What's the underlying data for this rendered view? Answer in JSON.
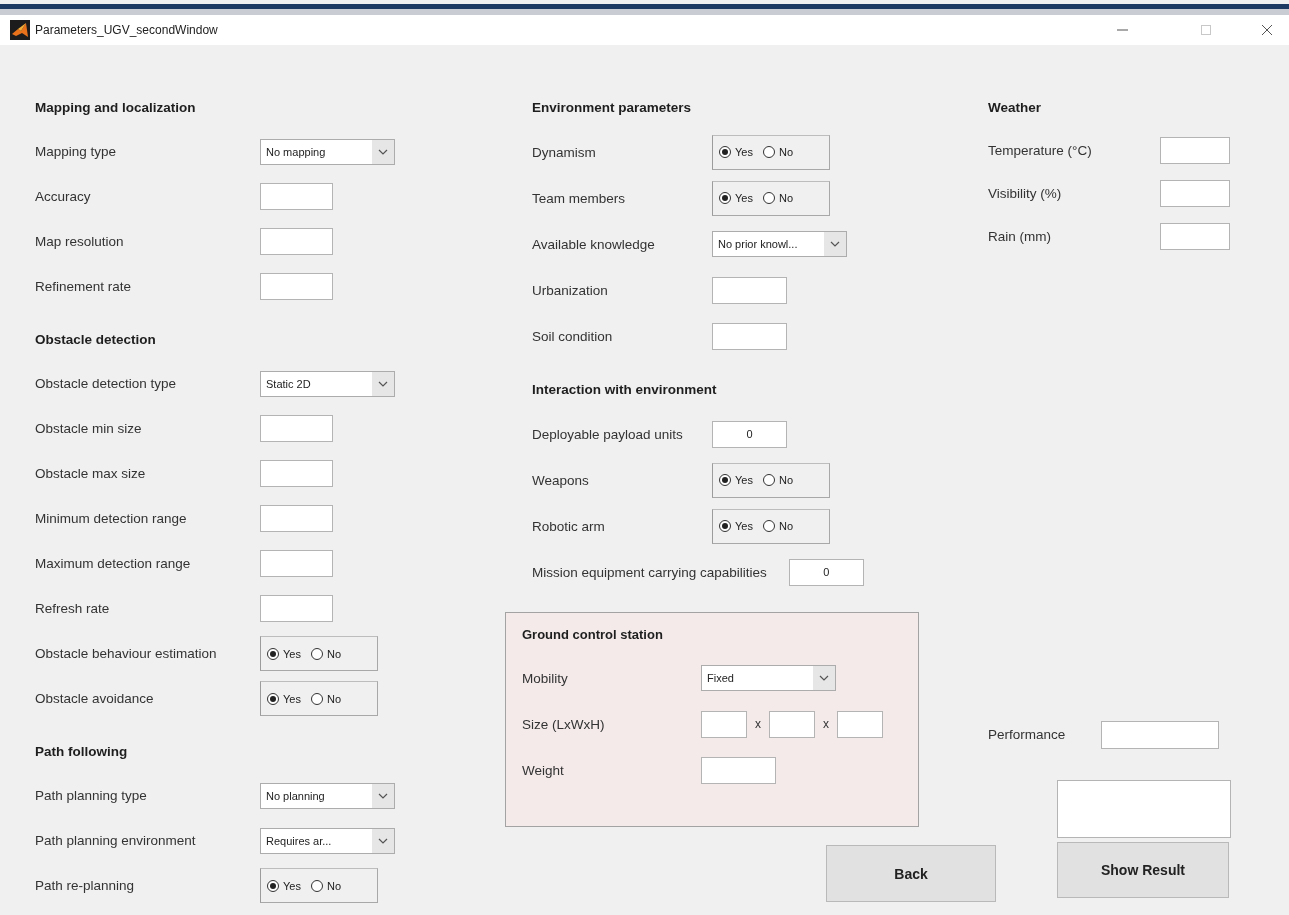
{
  "window": {
    "title": "Parameters_UGV_secondWindow"
  },
  "columns": [
    {
      "sections": [
        {
          "kind": "plain",
          "heading": "Mapping and localization",
          "rows": [
            {
              "label": "Mapping type",
              "kind": "dropdown",
              "value": "No mapping"
            },
            {
              "label": "Accuracy",
              "kind": "field"
            },
            {
              "label": "Map resolution",
              "kind": "field"
            },
            {
              "label": "Refinement rate",
              "kind": "field"
            }
          ]
        },
        {
          "kind": "plain",
          "heading": "Obstacle detection",
          "rows": [
            {
              "label": "Obstacle detection type",
              "kind": "dropdown",
              "value": "Static 2D"
            },
            {
              "label": "Obstacle min size",
              "kind": "field"
            },
            {
              "label": "Obstacle max size",
              "kind": "field"
            },
            {
              "label": "Minimum detection range",
              "kind": "field"
            },
            {
              "label": "Maximum detection range",
              "kind": "field"
            },
            {
              "label": "Refresh rate",
              "kind": "field"
            },
            {
              "label": "Obstacle behaviour estimation",
              "kind": "radio",
              "options": [
                {
                  "label": "Yes",
                  "selected": true
                },
                {
                  "label": "No",
                  "selected": false
                }
              ]
            },
            {
              "label": "Obstacle avoidance",
              "kind": "radio",
              "options": [
                {
                  "label": "Yes",
                  "selected": true
                },
                {
                  "label": "No",
                  "selected": false
                }
              ]
            }
          ]
        },
        {
          "kind": "plain",
          "heading": "Path following",
          "rows": [
            {
              "label": "Path planning type",
              "kind": "dropdown",
              "value": "No planning"
            },
            {
              "label": "Path planning environment",
              "kind": "dropdown",
              "value": "Requires ar..."
            },
            {
              "label": "Path re-planning",
              "kind": "radio",
              "options": [
                {
                  "label": "Yes",
                  "selected": true
                },
                {
                  "label": "No",
                  "selected": false
                }
              ]
            }
          ]
        }
      ]
    },
    {
      "sections": [
        {
          "kind": "plain",
          "heading": "Environment parameters",
          "rows": [
            {
              "label": "Dynamism",
              "kind": "radio",
              "options": [
                {
                  "label": "Yes",
                  "selected": true
                },
                {
                  "label": "No",
                  "selected": false
                }
              ]
            },
            {
              "label": "Team members",
              "kind": "radio",
              "options": [
                {
                  "label": "Yes",
                  "selected": true
                },
                {
                  "label": "No",
                  "selected": false
                }
              ]
            },
            {
              "label": "Available knowledge",
              "kind": "dropdown",
              "value": "No prior knowl..."
            },
            {
              "label": "Urbanization",
              "kind": "field"
            },
            {
              "label": "Soil condition",
              "kind": "field"
            }
          ]
        },
        {
          "kind": "plain",
          "heading": "Interaction with environment",
          "rows": [
            {
              "label": "Deployable payload units",
              "kind": "field",
              "value": "0"
            },
            {
              "label": "Weapons",
              "kind": "radio",
              "options": [
                {
                  "label": "Yes",
                  "selected": true
                },
                {
                  "label": "No",
                  "selected": false
                }
              ]
            },
            {
              "label": "Robotic arm",
              "kind": "radio",
              "options": [
                {
                  "label": "Yes",
                  "selected": true
                },
                {
                  "label": "No",
                  "selected": false
                }
              ]
            },
            {
              "label": "Mission equipment carrying capabilities",
              "kind": "field",
              "value": "0"
            }
          ]
        },
        {
          "kind": "panel",
          "heading": "Ground control station",
          "rows": [
            {
              "label": "Mobility",
              "kind": "dropdown",
              "value": "Fixed"
            },
            {
              "label": "Size (LxWxH)",
              "kind": "dimensions",
              "separators": [
                "x",
                "x"
              ]
            },
            {
              "label": "Weight",
              "kind": "field"
            }
          ]
        }
      ],
      "footer": [
        {
          "kind": "button",
          "label": "Back"
        }
      ]
    },
    {
      "sections": [
        {
          "kind": "plain",
          "heading": "Weather",
          "rows": [
            {
              "label": "Temperature (°C)",
              "kind": "field"
            },
            {
              "label": "Visibility (%)",
              "kind": "field"
            },
            {
              "label": "Rain (mm)",
              "kind": "field"
            }
          ]
        }
      ],
      "footer": [
        {
          "kind": "field",
          "label": "Performance"
        },
        {
          "kind": "output_box"
        },
        {
          "kind": "button",
          "label": "Show Result"
        }
      ]
    }
  ]
}
